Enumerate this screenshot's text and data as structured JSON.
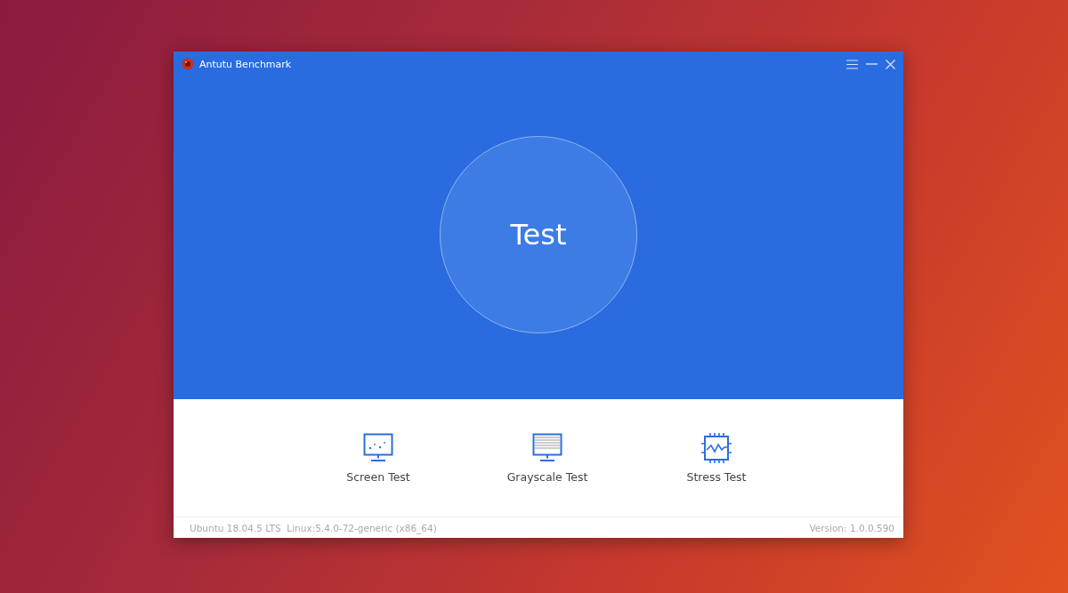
{
  "window": {
    "title": "Antutu Benchmark"
  },
  "main_button": {
    "label": "Test"
  },
  "tests": [
    {
      "kind": "screen",
      "label": "Screen Test"
    },
    {
      "kind": "grayscale",
      "label": "Grayscale Test"
    },
    {
      "kind": "stress",
      "label": "Stress Test"
    }
  ],
  "status_bar": {
    "system": "Ubuntu 18.04.5 LTS  Linux:5.4.0-72-generic (x86_64)",
    "version": "Version: 1.0.0.590"
  }
}
